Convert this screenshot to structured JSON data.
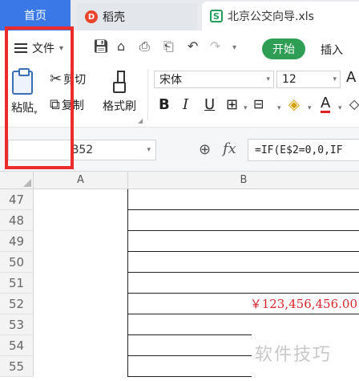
{
  "tabs": {
    "home": "首页",
    "daoke": "稻壳",
    "daoke_logo": "D",
    "file": "北京公交向导.xls",
    "file_logo": "S"
  },
  "ribbon": {
    "file_menu": "文件",
    "start": "开始",
    "insert": "插入",
    "paste": "粘贴",
    "cut": "剪切",
    "copy": "复制",
    "format_painter": "格式刷",
    "font_name": "宋体",
    "font_size": "12",
    "bold": "B",
    "italic": "I",
    "underline": "U",
    "font_color_glyph": "A",
    "font_grow_glyph": "A"
  },
  "formula_bar": {
    "cell_ref": "B52",
    "fx": "fx",
    "formula": "=IF(E$2=0,0,IF"
  },
  "grid": {
    "columns": [
      "A",
      "B"
    ],
    "rows": [
      {
        "num": "47",
        "b": ""
      },
      {
        "num": "48",
        "b": ""
      },
      {
        "num": "49",
        "b": ""
      },
      {
        "num": "50",
        "b": ""
      },
      {
        "num": "51",
        "b": ""
      },
      {
        "num": "52",
        "b": "￥123,456,456.00"
      },
      {
        "num": "53",
        "b": ""
      },
      {
        "num": "54",
        "b": ""
      },
      {
        "num": "55",
        "b": ""
      }
    ]
  },
  "watermark": "软件技巧",
  "colors": {
    "home_tab": "#3a78e8",
    "start_button": "#2f9e55",
    "highlight_box": "#ee2b2b",
    "currency_text": "#d9262c"
  }
}
